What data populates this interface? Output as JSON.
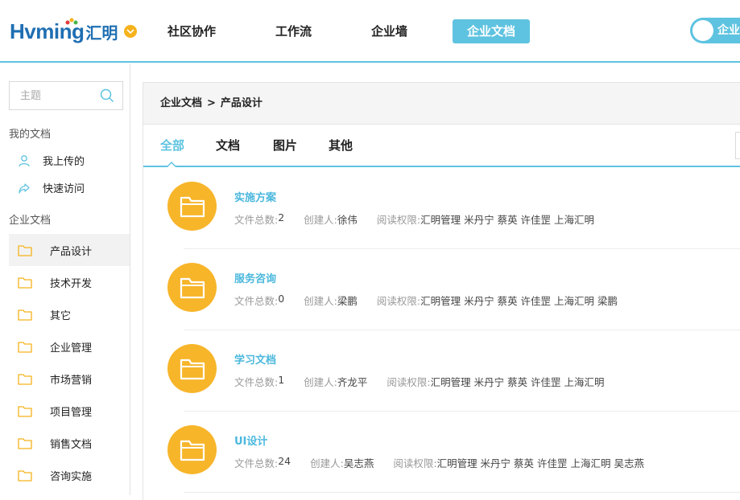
{
  "header": {
    "logo_text": "Hvming",
    "logo_cn": "汇明",
    "nav": [
      "社区协作",
      "工作流",
      "企业墙",
      "企业文档"
    ],
    "active_nav_index": 3,
    "toggle_label": "企业管"
  },
  "sidebar": {
    "search_placeholder": "主题",
    "my_docs_title": "我的文档",
    "my_docs_items": [
      "我上传的",
      "快速访问"
    ],
    "enterprise_docs_title": "企业文档",
    "folders": [
      "产品设计",
      "技术开发",
      "其它",
      "企业管理",
      "市场营销",
      "项目管理",
      "销售文档",
      "咨询实施"
    ],
    "active_folder_index": 0
  },
  "breadcrumb": {
    "root": "企业文档",
    "separator": ">",
    "current": "产品设计"
  },
  "tabs": [
    "全部",
    "文档",
    "图片",
    "其他"
  ],
  "active_tab_index": 0,
  "meta_labels": {
    "count": "文件总数:",
    "creator": "创建人:",
    "permission": "阅读权限:"
  },
  "documents": [
    {
      "name": "实施方案",
      "count": "2",
      "creator": "徐伟",
      "permission": "汇明管理 米丹宁 蔡英 许佳罡 上海汇明"
    },
    {
      "name": "服务咨询",
      "count": "0",
      "creator": "梁鹏",
      "permission": "汇明管理 米丹宁 蔡英 许佳罡 上海汇明 梁鹏"
    },
    {
      "name": "学习文档",
      "count": "1",
      "creator": "齐龙平",
      "permission": "汇明管理 米丹宁 蔡英 许佳罡 上海汇明"
    },
    {
      "name": "UI设计",
      "count": "24",
      "creator": "吴志燕",
      "permission": "汇明管理 米丹宁 蔡英 许佳罡 上海汇明 吴志燕"
    }
  ],
  "colors": {
    "accent": "#5ec3e0",
    "folder_circle": "#f7b52a",
    "brand": "#1f6fb2"
  }
}
